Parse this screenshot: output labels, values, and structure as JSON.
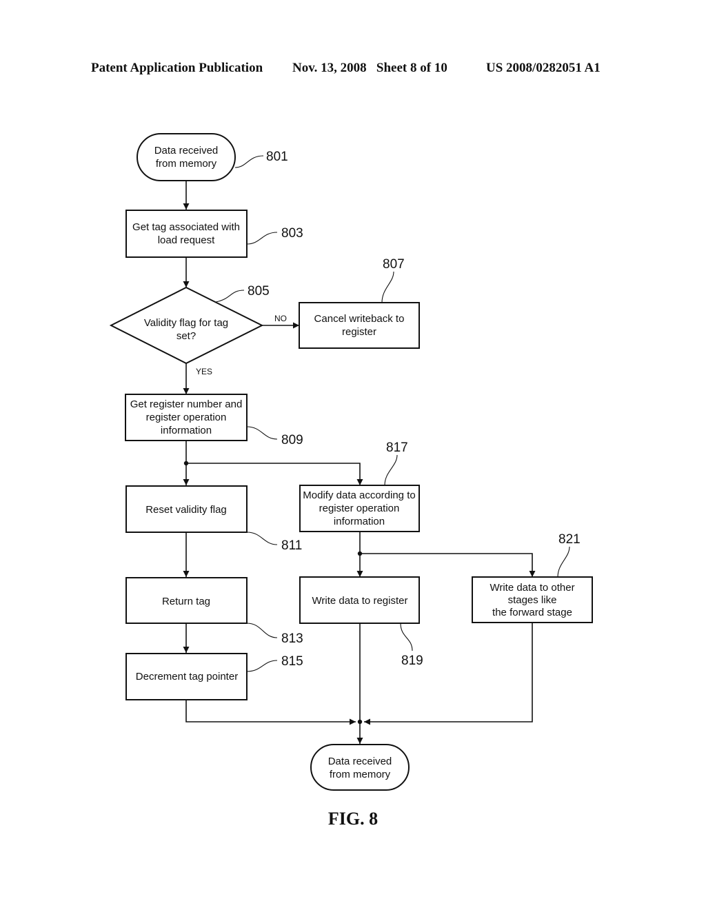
{
  "header": {
    "publication": "Patent Application Publication",
    "date_sheet": "Nov. 13, 2008   Sheet 8 of 10",
    "patent_number": "US 2008/0282051 A1"
  },
  "figure_label": "FIG. 8",
  "nodes": {
    "n801": {
      "type": "terminal",
      "ref": "801",
      "lines": [
        "Data received",
        "from memory"
      ]
    },
    "n803": {
      "type": "process",
      "ref": "803",
      "lines": [
        "Get tag associated with",
        "load request"
      ]
    },
    "n805": {
      "type": "decision",
      "ref": "805",
      "lines": [
        "Validity flag for tag",
        "set?"
      ]
    },
    "n807": {
      "type": "process",
      "ref": "807",
      "lines": [
        "Cancel writeback to",
        "register"
      ]
    },
    "n809": {
      "type": "process",
      "ref": "809",
      "lines": [
        "Get register number and",
        "register operation",
        "information"
      ]
    },
    "n811": {
      "type": "process",
      "ref": "811",
      "lines": [
        "Reset validity flag"
      ]
    },
    "n813": {
      "type": "process",
      "ref": "813",
      "lines": [
        "Return tag"
      ]
    },
    "n815": {
      "type": "process",
      "ref": "815",
      "lines": [
        "Decrement tag pointer"
      ]
    },
    "n817": {
      "type": "process",
      "ref": "817",
      "lines": [
        "Modify data according to",
        "register operation",
        "information"
      ]
    },
    "n819": {
      "type": "process",
      "ref": "819",
      "lines": [
        "Write data to register"
      ]
    },
    "n821": {
      "type": "process",
      "ref": "821",
      "lines": [
        "Write data to other",
        "stages like",
        "the forward stage"
      ]
    },
    "end": {
      "type": "terminal",
      "lines": [
        "Data received",
        "from memory"
      ]
    }
  },
  "edge_labels": {
    "no": "NO",
    "yes": "YES"
  },
  "edges": [
    {
      "from": "n801",
      "to": "n803"
    },
    {
      "from": "n803",
      "to": "n805"
    },
    {
      "from": "n805",
      "to": "n807",
      "label": "NO"
    },
    {
      "from": "n805",
      "to": "n809",
      "label": "YES"
    },
    {
      "from": "n809",
      "to": "n811"
    },
    {
      "from": "n809",
      "to": "n817"
    },
    {
      "from": "n811",
      "to": "n813"
    },
    {
      "from": "n813",
      "to": "n815"
    },
    {
      "from": "n817",
      "to": "n819"
    },
    {
      "from": "n817",
      "to": "n821"
    },
    {
      "from": "n815",
      "to": "end"
    },
    {
      "from": "n819",
      "to": "end"
    },
    {
      "from": "n821",
      "to": "end"
    }
  ]
}
